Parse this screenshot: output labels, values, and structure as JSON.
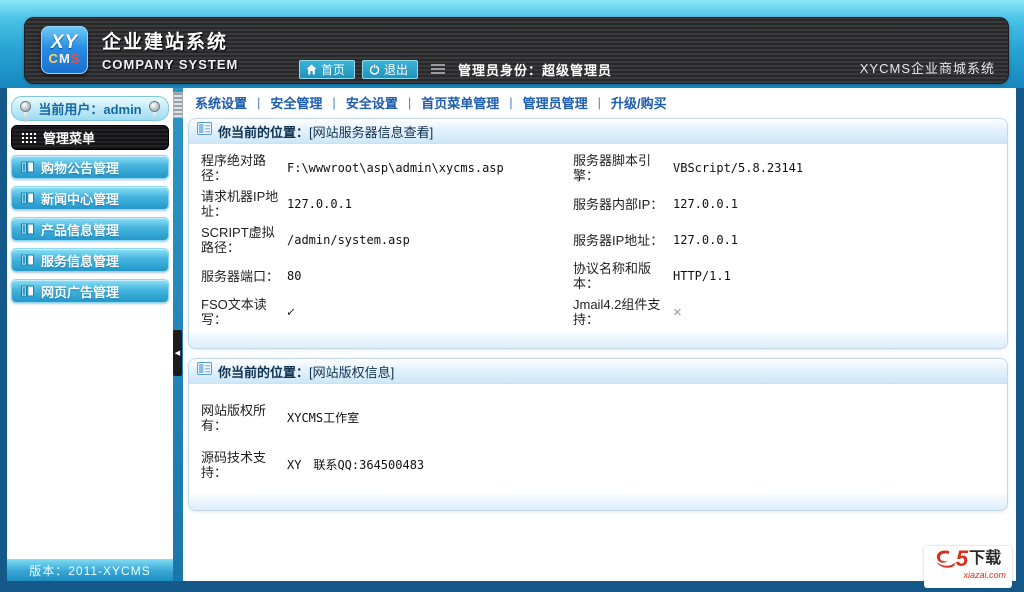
{
  "header": {
    "logo": {
      "top": "XY",
      "bottom": "CMS"
    },
    "title_cn": "企业建站系统",
    "title_en": "COMPANY SYSTEM",
    "home_button": "首页",
    "logout_button": "退出",
    "admin_identity": "管理员身份：超级管理员",
    "system_name": "XYCMS企业商城系统"
  },
  "nav": {
    "items": [
      "系统设置",
      "安全管理",
      "安全设置",
      "首页菜单管理",
      "管理员管理",
      "升级/购买"
    ],
    "separator": "|"
  },
  "sidebar": {
    "current_user": "当前用户：admin",
    "menu_title": "管理菜单",
    "items": [
      "购物公告管理",
      "新闻中心管理",
      "产品信息管理",
      "服务信息管理",
      "网页广告管理"
    ],
    "version": "版本：2011-XYCMS"
  },
  "server_panel": {
    "title_prefix": "你当前的位置：",
    "location": "[网站服务器信息查看]",
    "rows": [
      {
        "cells": [
          {
            "label": "程序绝对路径：",
            "value": "F:\\wwwroot\\asp\\admin\\xycms.asp"
          },
          {
            "label": "服务器脚本引擎：",
            "value": "VBScript/5.8.23141"
          }
        ]
      },
      {
        "cells": [
          {
            "label": "请求机器IP地址：",
            "value": "127.0.0.1"
          },
          {
            "label": "服务器内部IP：",
            "value": "127.0.0.1"
          }
        ]
      },
      {
        "cells": [
          {
            "label": "SCRIPT虚拟路径：",
            "value": "/admin/system.asp"
          },
          {
            "label": "服务器IP地址：",
            "value": "127.0.0.1"
          }
        ]
      },
      {
        "cells": [
          {
            "label": "服务器端口：",
            "value": "80"
          },
          {
            "label": "协议名称和版本：",
            "value": "HTTP/1.1"
          }
        ]
      },
      {
        "cells": [
          {
            "label": "FSO文本读写：",
            "value": "✓",
            "status": "ok"
          },
          {
            "label": "Jmail4.2组件支持：",
            "value": "×",
            "status": "no"
          }
        ]
      }
    ]
  },
  "copyright_panel": {
    "title_prefix": "你当前的位置：",
    "location": "[网站版权信息]",
    "rows": [
      {
        "label": "网站版权所有：",
        "value": "XYCMS工作室"
      },
      {
        "label": "源码技术支持：",
        "value": "XY　联系QQ:364500483"
      }
    ]
  },
  "watermark": {
    "big5": "5",
    "download": "下载",
    "site": "xiazai.com"
  }
}
